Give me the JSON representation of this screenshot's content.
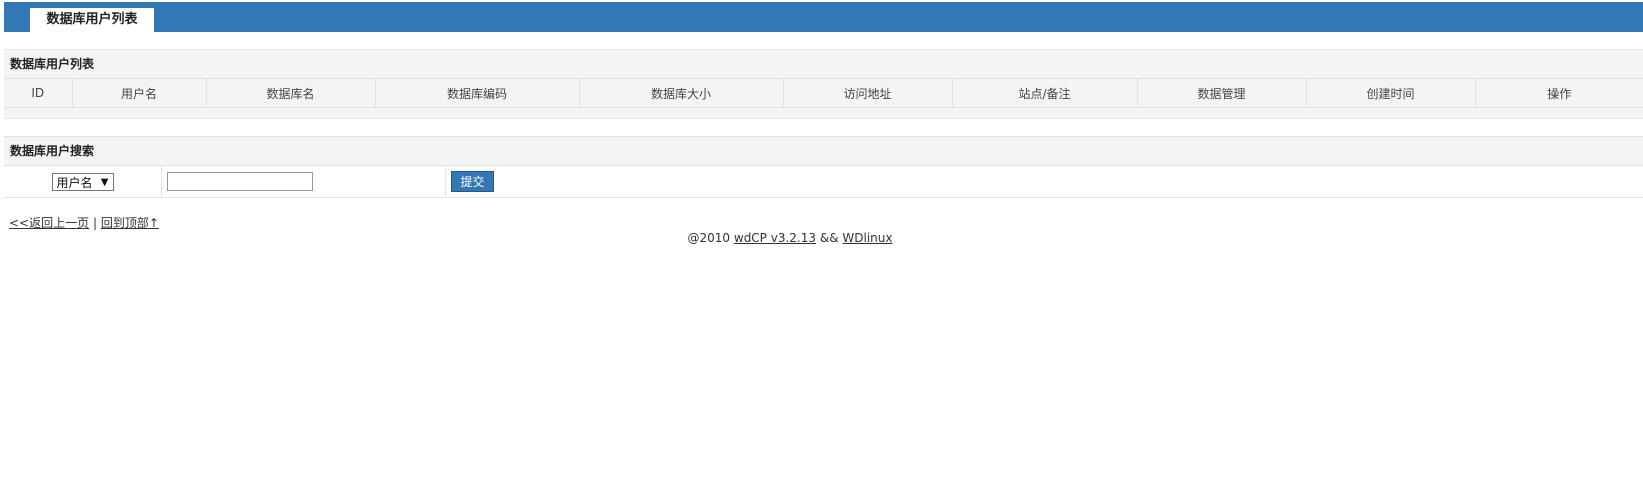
{
  "header": {
    "tab_label": "数据库用户列表"
  },
  "list": {
    "title": "数据库用户列表",
    "columns": [
      "ID",
      "用户名",
      "数据库名",
      "数据库编码",
      "数据库大小",
      "访问地址",
      "站点/备注",
      "数据管理",
      "创建时间",
      "操作"
    ]
  },
  "search": {
    "title": "数据库用户搜索",
    "field_selected": "用户名",
    "input_value": "",
    "submit_label": "提交"
  },
  "nav": {
    "back_label": "<<返回上一页",
    "separator": "|",
    "top_label": "回到顶部↑"
  },
  "footer": {
    "copyright": "@2010",
    "product_link": "wdCP v3.2.13",
    "and_text": "&&",
    "vendor_link": "WDlinux"
  },
  "colors": {
    "accent": "#3377b4",
    "panel_bg": "#f2f4f6",
    "border": "#dfe3e8"
  }
}
